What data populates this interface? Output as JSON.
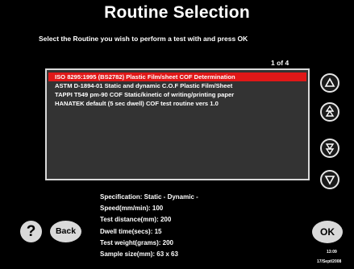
{
  "title": "Routine Selection",
  "instruction": "Select the Routine you wish to perform a test with and press OK",
  "page_indicator": "1 of 4",
  "routines": [
    "ISO 8295:1995 (BS2782) Plastic Film/sheet COF Determination",
    "ASTM D-1894-01 Static and dynamic C.O.F Plastic Film/Sheet",
    "TAPPI T549 pm-90 COF Static/kinetic of writing/printing paper",
    "HANATEK default (5 sec dwell) COF test routine vers 1.0"
  ],
  "selected_index": 0,
  "scroll_buttons": [
    "scroll-up-icon",
    "page-up-icon",
    "page-down-icon",
    "scroll-down-icon"
  ],
  "spec": {
    "specification": "Specification: Static - Dynamic -",
    "speed": "Speed(mm/min): 100",
    "distance": "Test distance(mm): 200",
    "dwell": "Dwell time(secs): 15",
    "weight": "Test weight(grams): 200",
    "sample": "Sample size(mm): 63 x 63"
  },
  "buttons": {
    "help": "?",
    "back": "Back",
    "ok": "OK"
  },
  "clock": {
    "time": "13:09",
    "date": "17/Sept/2008"
  },
  "colors": {
    "background": "#000000",
    "selection": "#e01818",
    "list_background": "#333333",
    "button": "#d9d9d9"
  }
}
